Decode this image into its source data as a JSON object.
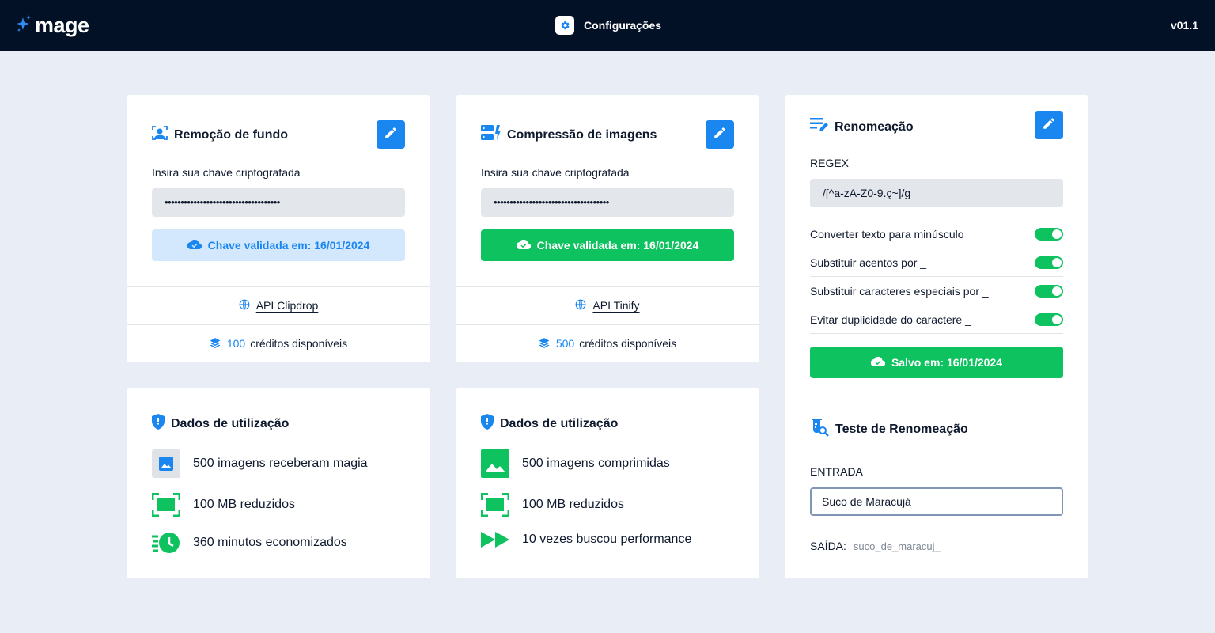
{
  "app": {
    "name": "mage",
    "page_title": "Configurações",
    "version": "v01.1"
  },
  "bg_removal": {
    "title": "Remoção de fundo",
    "key_label": "Insira sua chave criptografada",
    "key_value": "••••••••••••••••••••••••••••••••••••",
    "status_button": "Chave validada em: 16/01/2024",
    "api_link": "API Clipdrop",
    "credits_count": "100",
    "credits_label": "créditos disponíveis"
  },
  "compression": {
    "title": "Compressão de imagens",
    "key_label": "Insira sua chave criptografada",
    "key_value": "••••••••••••••••••••••••••••••••••••",
    "status_button": "Chave validada em: 16/01/2024",
    "api_link": "API Tinify",
    "credits_count": "500",
    "credits_label": "créditos disponíveis"
  },
  "usage_bg": {
    "title": "Dados de utilização",
    "rows": [
      "500 imagens receberam magia",
      "100 MB reduzidos",
      "360 minutos economizados"
    ]
  },
  "usage_compression": {
    "title": "Dados de utilização",
    "rows": [
      "500 imagens comprimidas",
      "100 MB reduzidos",
      "10 vezes buscou performance"
    ]
  },
  "rename": {
    "title": "Renomeação",
    "regex_label": "REGEX",
    "regex_value": "/[^a-zA-Z0-9.ç~]/g",
    "options": [
      {
        "label": "Converter texto para minúsculo",
        "on": true
      },
      {
        "label": "Substituir acentos por _",
        "on": true
      },
      {
        "label": "Substituir caracteres especiais por _",
        "on": true
      },
      {
        "label": "Evitar duplicidade do caractere _",
        "on": true
      }
    ],
    "save_button": "Salvo em: 16/01/2024"
  },
  "rename_test": {
    "title": "Teste de Renomeação",
    "input_label": "ENTRADA",
    "input_value": "Suco de Maracujá",
    "output_label": "SAÍDA:",
    "output_value": "suco_de_maracuj_"
  },
  "colors": {
    "accent": "#1a86f0",
    "success": "#0ec260",
    "topbar": "#031126",
    "page_bg": "#e9eef6"
  },
  "icons": {
    "logo": "sparkle-icon",
    "settings": "gear-icon",
    "edit": "pencil-icon",
    "bg_removal": "person-scan-icon",
    "compression": "server-bolt-icon",
    "rename": "text-edit-icon",
    "rename_test": "flask-search-icon",
    "usage": "shield-icon",
    "cloud": "cloud-check-icon",
    "globe": "globe-icon",
    "credits": "layers-icon",
    "image": "image-icon",
    "compress": "frame-compress-icon",
    "clock": "fast-clock-icon",
    "forward": "fast-forward-icon"
  }
}
